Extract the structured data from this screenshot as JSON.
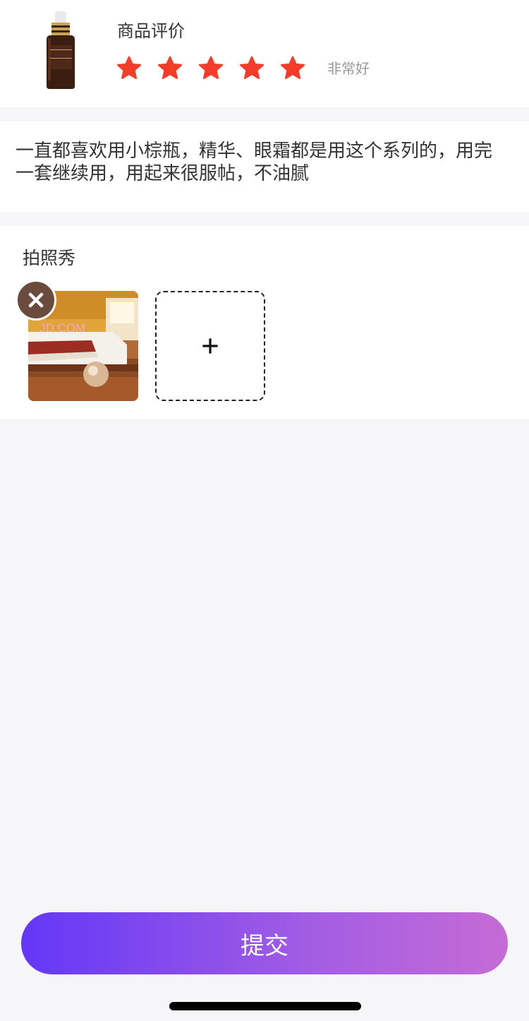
{
  "rating": {
    "title": "商品评价",
    "stars_total": 5,
    "stars_selected": 5,
    "star_color": "#f23d2a",
    "label": "非常好"
  },
  "review": {
    "text": "一直都喜欢用小棕瓶，精华、眼霜都是用这个系列的，用完一套继续用，用起来很服帖，不油腻"
  },
  "photos": {
    "title": "拍照秀",
    "watermark": "JD.COM"
  },
  "submit": {
    "label": "提交"
  },
  "colors": {
    "accent_start": "#6437f7",
    "accent_end": "#c66bd6",
    "remove_badge": "#6b4b3e"
  },
  "icons": {
    "product": "serum-bottle-image",
    "star": "star-icon",
    "remove": "close-icon",
    "add": "plus-icon"
  }
}
